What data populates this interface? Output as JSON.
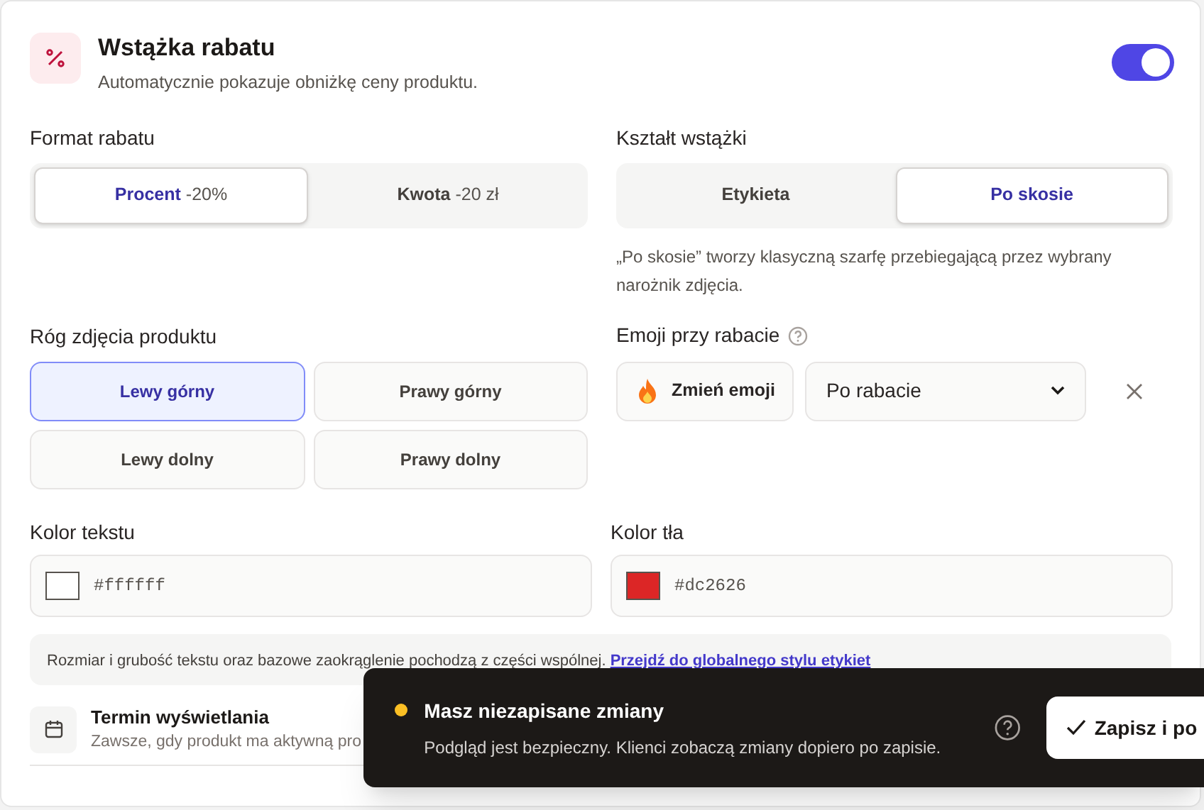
{
  "header": {
    "title": "Wstążka rabatu",
    "subtitle": "Automatycznie pokazuje obniżkę ceny produktu.",
    "enabled": true
  },
  "discount_format": {
    "label": "Format rabatu",
    "options": [
      {
        "name": "Procent",
        "value": "-20%",
        "selected": true
      },
      {
        "name": "Kwota",
        "value": "-20 zł",
        "selected": false
      }
    ]
  },
  "ribbon_shape": {
    "label": "Kształt wstążki",
    "options": [
      {
        "label": "Etykieta",
        "selected": false
      },
      {
        "label": "Po skosie",
        "selected": true
      }
    ],
    "hint": "„Po skosie” tworzy klasyczną szarfę przebiegającą przez wybrany narożnik zdjęcia."
  },
  "photo_corner": {
    "label": "Róg zdjęcia produktu",
    "options": [
      {
        "label": "Lewy górny",
        "selected": true
      },
      {
        "label": "Prawy górny",
        "selected": false
      },
      {
        "label": "Lewy dolny",
        "selected": false
      },
      {
        "label": "Prawy dolny",
        "selected": false
      }
    ]
  },
  "emoji": {
    "label": "Emoji przy rabacie",
    "button": "Zmień emoji",
    "position": "Po rabacie"
  },
  "text_color": {
    "label": "Kolor tekstu",
    "value": "#ffffff"
  },
  "background_color": {
    "label": "Kolor tła",
    "value": "#dc2626"
  },
  "info": {
    "text": "Rozmiar i grubość tekstu oraz bazowe zaokrąglenie pochodzą z części wspólnej.",
    "link": "Przejdź do globalnego stylu etykiet"
  },
  "display_term": {
    "title": "Termin wyświetlania",
    "subtitle": "Zawsze, gdy produkt ma aktywną pro"
  },
  "toast": {
    "title": "Masz niezapisane zmiany",
    "message": "Podgląd jest bezpieczny. Klienci zobaczą zmiany dopiero po zapisie.",
    "button": "Zapisz i po"
  }
}
